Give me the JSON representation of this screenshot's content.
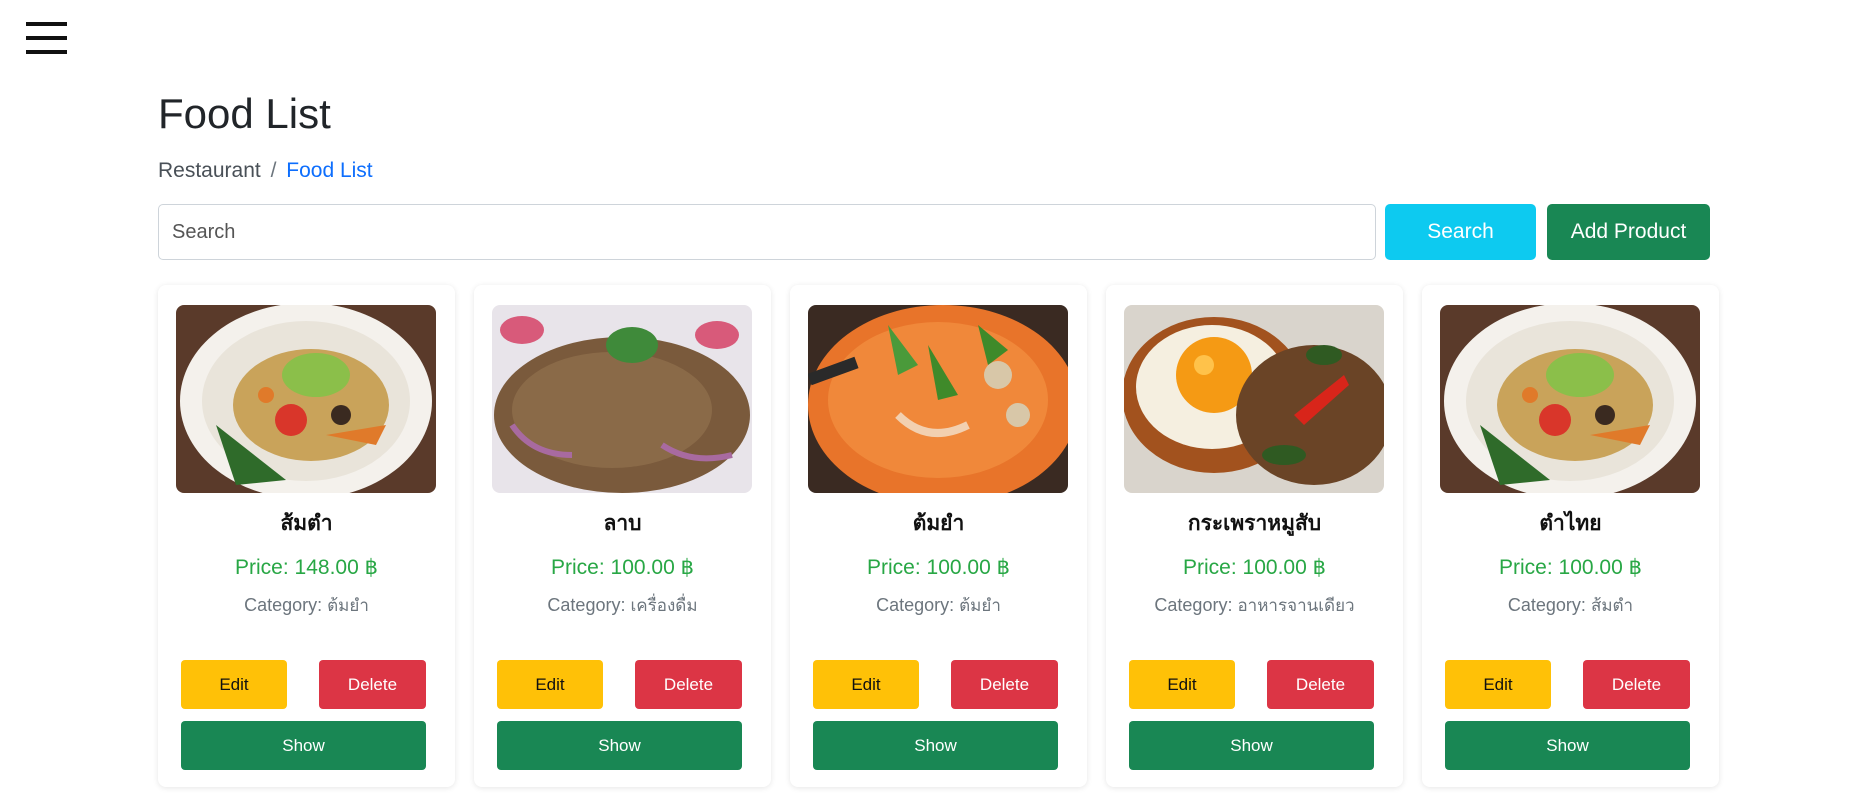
{
  "header": {
    "menu_icon": "hamburger-menu-icon",
    "title": "Food List"
  },
  "breadcrumb": {
    "root": "Restaurant",
    "separator": "/",
    "current": "Food List"
  },
  "search": {
    "placeholder": "Search",
    "value": "",
    "button_label": "Search",
    "add_label": "Add Product"
  },
  "colors": {
    "search_button": "#0dcaf0",
    "add_button": "#198754",
    "edit_button": "#ffc107",
    "delete_button": "#dc3545",
    "show_button": "#198754",
    "price_text": "#28a745",
    "breadcrumb_active": "#0d6efd"
  },
  "foods": [
    {
      "name": "ส้มตำ",
      "price": "Price: 148.00 ฿",
      "category_label": "Category:",
      "category": "ต้มยำ",
      "image": "papaya-salad-photo",
      "edit_label": "Edit",
      "delete_label": "Delete",
      "show_label": "Show"
    },
    {
      "name": "ลาบ",
      "price": "Price: 100.00 ฿",
      "category_label": "Category:",
      "category": "เครื่องดื่ม",
      "image": "larb-photo",
      "edit_label": "Edit",
      "delete_label": "Delete",
      "show_label": "Show"
    },
    {
      "name": "ต้มยำ",
      "price": "Price: 100.00 ฿",
      "category_label": "Category:",
      "category": "ต้มยำ",
      "image": "tom-yum-photo",
      "edit_label": "Edit",
      "delete_label": "Delete",
      "show_label": "Show"
    },
    {
      "name": "กระเพราหมูสับ",
      "price": "Price: 100.00 ฿",
      "category_label": "Category:",
      "category": "อาหารจานเดียว",
      "image": "krapow-moo-sub-photo",
      "edit_label": "Edit",
      "delete_label": "Delete",
      "show_label": "Show"
    },
    {
      "name": "ตำไทย",
      "price": "Price: 100.00 ฿",
      "category_label": "Category:",
      "category": "ส้มตำ",
      "image": "som-tam-thai-photo",
      "edit_label": "Edit",
      "delete_label": "Delete",
      "show_label": "Show"
    }
  ]
}
